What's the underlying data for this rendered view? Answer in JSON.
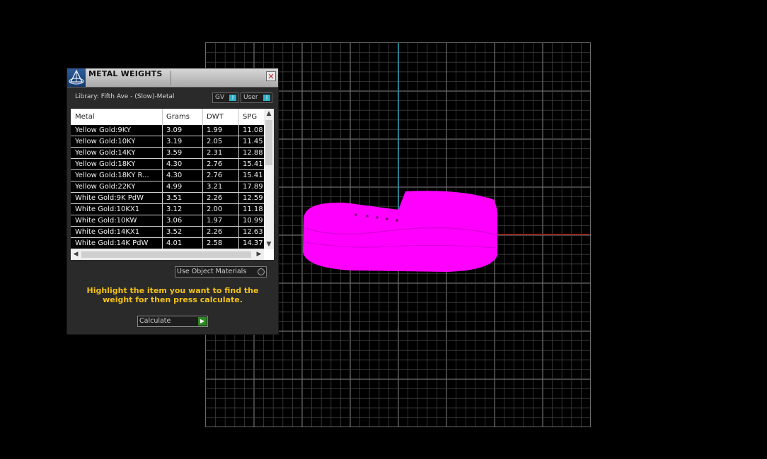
{
  "panel": {
    "title": "METAL WEIGHTS",
    "close_label": "✕",
    "library_text": "Library: Fifth Ave - (Slow)-Metal",
    "toggle_gv_label": "GV",
    "toggle_user_label": "User",
    "toggle_knob_glyph": "I",
    "use_object_materials_label": "Use Object Materials",
    "instruction": "Highlight the item you want to find the weight for then press calculate.",
    "calculate_label": "Calculate",
    "calculate_icon": "play-arrow-icon",
    "accent_color": "#f2c21a"
  },
  "table": {
    "columns": [
      "Metal",
      "Grams",
      "DWT",
      "SPG"
    ],
    "rows": [
      [
        "Yellow Gold:9KY",
        "3.09",
        "1.99",
        "11.08"
      ],
      [
        "Yellow Gold:10KY",
        "3.19",
        "2.05",
        "11.45"
      ],
      [
        "Yellow Gold:14KY",
        "3.59",
        "2.31",
        "12.88"
      ],
      [
        "Yellow Gold:18KY",
        "4.30",
        "2.76",
        "15.41"
      ],
      [
        "Yellow Gold:18KY R...",
        "4.30",
        "2.76",
        "15.41"
      ],
      [
        "Yellow Gold:22KY",
        "4.99",
        "3.21",
        "17.89"
      ],
      [
        "White Gold:9K PdW",
        "3.51",
        "2.26",
        "12.59"
      ],
      [
        "White Gold:10KX1",
        "3.12",
        "2.00",
        "11.18"
      ],
      [
        "White Gold:10KW",
        "3.06",
        "1.97",
        "10.99"
      ],
      [
        "White Gold:14KX1",
        "3.52",
        "2.26",
        "12.63"
      ],
      [
        "White Gold:14K PdW",
        "4.01",
        "2.58",
        "14.37"
      ]
    ]
  },
  "viewport": {
    "grid_color": "#3c3c3c",
    "major_grid_color": "#6e6e6e",
    "axis_y_color": "#2aa0b4",
    "axis_x_color": "#b01a10",
    "object_color": "#ff00ff"
  }
}
